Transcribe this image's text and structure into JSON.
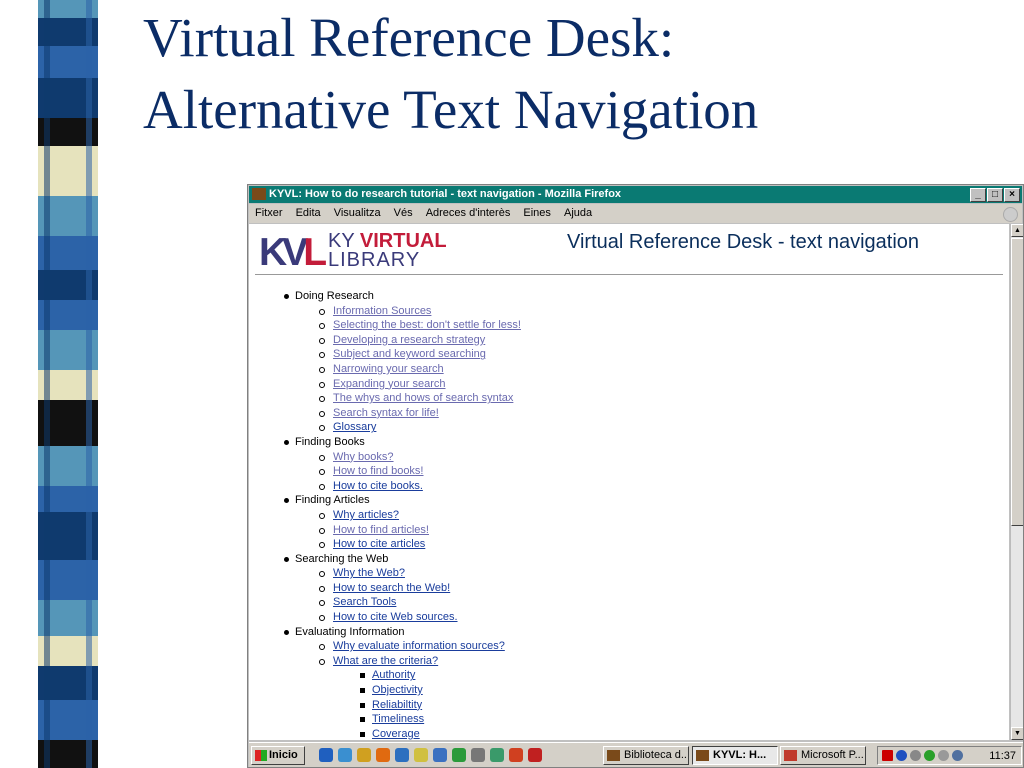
{
  "slide": {
    "title_line1": "Virtual Reference Desk:",
    "title_line2": "Alternative Text Navigation"
  },
  "colors": {
    "slide_title": "#0b2c66",
    "window_titlebar": "#0a7a73",
    "link": "#1a3d9c",
    "visited_link": "#6a6aaf",
    "stripe_navy": "#0f3a6e",
    "stripe_teal": "#5596b8",
    "stripe_cream": "#e6e3bd",
    "stripe_blue": "#2c63a8"
  },
  "browser": {
    "window_title": "KYVL: How to do research tutorial - text navigation - Mozilla Firefox",
    "window_buttons": [
      "_",
      "□",
      "×"
    ],
    "menu": [
      "Fitxer",
      "Edita",
      "Visualitza",
      "Vés",
      "Adreces d'interès",
      "Eines",
      "Ajuda"
    ]
  },
  "page": {
    "logo_mark": "KVL",
    "logo_ky": "KY",
    "logo_virtual": "VIRTUAL",
    "logo_library": "LIBRARY",
    "heading": "Virtual Reference Desk - text navigation"
  },
  "toc": [
    {
      "title": "Doing Research",
      "items": [
        {
          "label": "Information Sources",
          "visited": true
        },
        {
          "label": "Selecting the best: don't settle for less!",
          "visited": true
        },
        {
          "label": "Developing a research strategy",
          "visited": true
        },
        {
          "label": "Subject and keyword searching",
          "visited": true
        },
        {
          "label": "Narrowing your search",
          "visited": true
        },
        {
          "label": "Expanding your search",
          "visited": true
        },
        {
          "label": "The whys and hows of search syntax",
          "visited": true
        },
        {
          "label": "Search syntax for life!",
          "visited": true
        },
        {
          "label": "Glossary",
          "visited": false
        }
      ]
    },
    {
      "title": "Finding Books",
      "items": [
        {
          "label": "Why books?",
          "visited": true
        },
        {
          "label": "How to find books!",
          "visited": true
        },
        {
          "label": "How to cite books.",
          "visited": false
        }
      ]
    },
    {
      "title": "Finding Articles",
      "items": [
        {
          "label": "Why articles?",
          "visited": false
        },
        {
          "label": "How to find articles!",
          "visited": true
        },
        {
          "label": "How to cite articles",
          "visited": false
        }
      ]
    },
    {
      "title": "Searching the Web",
      "items": [
        {
          "label": "Why the Web?",
          "visited": false
        },
        {
          "label": "How to search the Web!",
          "visited": false
        },
        {
          "label": "Search Tools",
          "visited": false
        },
        {
          "label": "How to cite Web sources.",
          "visited": false
        }
      ]
    },
    {
      "title": "Evaluating Information",
      "items": [
        {
          "label": "Why evaluate information sources?",
          "visited": false
        },
        {
          "label": "What are the criteria?",
          "visited": false,
          "sub": [
            "Authority",
            "Objectivity",
            "Reliabiltity",
            "Timeliness",
            "Coverage"
          ]
        }
      ]
    }
  ],
  "taskbar": {
    "start": "Inicio",
    "quick_launch": [
      "ie-icon",
      "outlook-icon",
      "search-icon",
      "firefox-icon",
      "word-icon",
      "edit-icon",
      "refresh-icon",
      "recycle-icon",
      "tool-icon",
      "media-icon",
      "powerpoint-icon",
      "opera-icon"
    ],
    "windows": [
      {
        "label": "Biblioteca d...",
        "active": false,
        "icon_color": "#7a4a1a"
      },
      {
        "label": "KYVL: H...",
        "active": true,
        "icon_color": "#7a4a1a"
      },
      {
        "label": "Microsoft P...",
        "active": false,
        "icon_color": "#c0392b"
      }
    ],
    "clock": "11:37"
  }
}
